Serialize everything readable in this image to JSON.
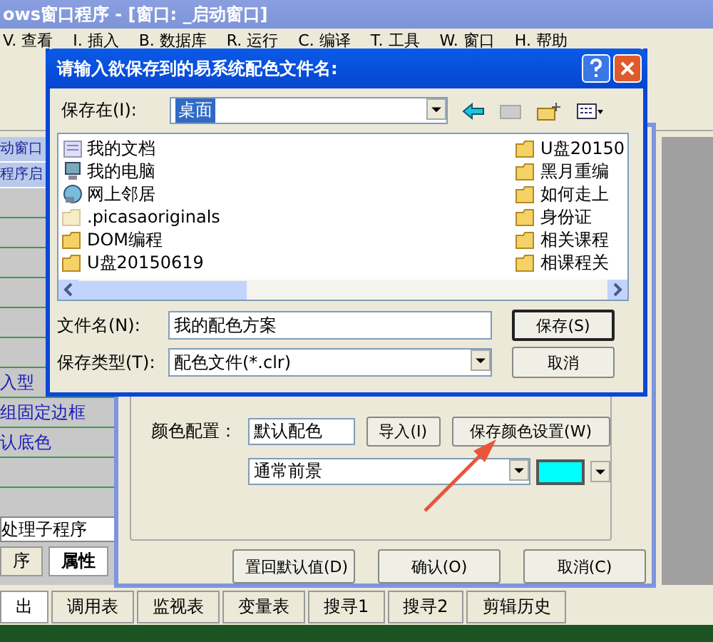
{
  "main_window": {
    "title": "ows窗口程序 - [窗口: _启动窗口]"
  },
  "menu": [
    "V. 查看",
    "I. 插入",
    "B. 数据库",
    "R. 运行",
    "C. 编译",
    "T. 工具",
    "W. 窗口",
    "H. 帮助"
  ],
  "left_panel": {
    "headers": [
      "动窗口",
      "程序启"
    ],
    "links": [
      "入型",
      "组固定边框",
      "认底色"
    ],
    "dropdown": "处理子程序",
    "tabs": [
      {
        "label": "序",
        "selected": false
      },
      {
        "label": "属性",
        "selected": true
      }
    ]
  },
  "bottom_tabs": [
    {
      "label": "出",
      "selected": true
    },
    {
      "label": "调用表",
      "selected": false
    },
    {
      "label": "监视表",
      "selected": false
    },
    {
      "label": "变量表",
      "selected": false
    },
    {
      "label": "搜寻1",
      "selected": false
    },
    {
      "label": "搜寻2",
      "selected": false
    },
    {
      "label": "剪辑历史",
      "selected": false
    }
  ],
  "color_dialog": {
    "scheme_label": "颜色配置：",
    "scheme": "默认配色",
    "import_button": "导入(I)",
    "save_button": "保存颜色设置(W)",
    "element": "通常前景",
    "buttons": [
      "置回默认值(D)",
      "确认(O)",
      "取消(C)"
    ]
  },
  "save_dialog": {
    "title": "请输入欲保存到的易系统配色文件名:",
    "location_label": "保存在(I):",
    "location": "桌面",
    "files": [
      {
        "name": "我的文档",
        "kind": "documents"
      },
      {
        "name": "我的电脑",
        "kind": "computer"
      },
      {
        "name": "网上邻居",
        "kind": "network"
      },
      {
        "name": ".picasaoriginals",
        "kind": "hidden-folder"
      },
      {
        "name": "DOM编程",
        "kind": "folder"
      },
      {
        "name": "U盘20150619",
        "kind": "folder"
      },
      {
        "name": "U盘20150",
        "kind": "folder"
      },
      {
        "name": "黑月重编",
        "kind": "folder"
      },
      {
        "name": "如何走上",
        "kind": "folder"
      },
      {
        "name": "身份证",
        "kind": "folder"
      },
      {
        "name": "相关课程",
        "kind": "folder"
      },
      {
        "name": "相课程关",
        "kind": "folder"
      }
    ],
    "filename_label": "文件名(N):",
    "filename": "我的配色方案",
    "type_label": "保存类型(T):",
    "type": "配色文件(*.clr)",
    "save_button": "保存(S)",
    "cancel_button": "取消"
  }
}
